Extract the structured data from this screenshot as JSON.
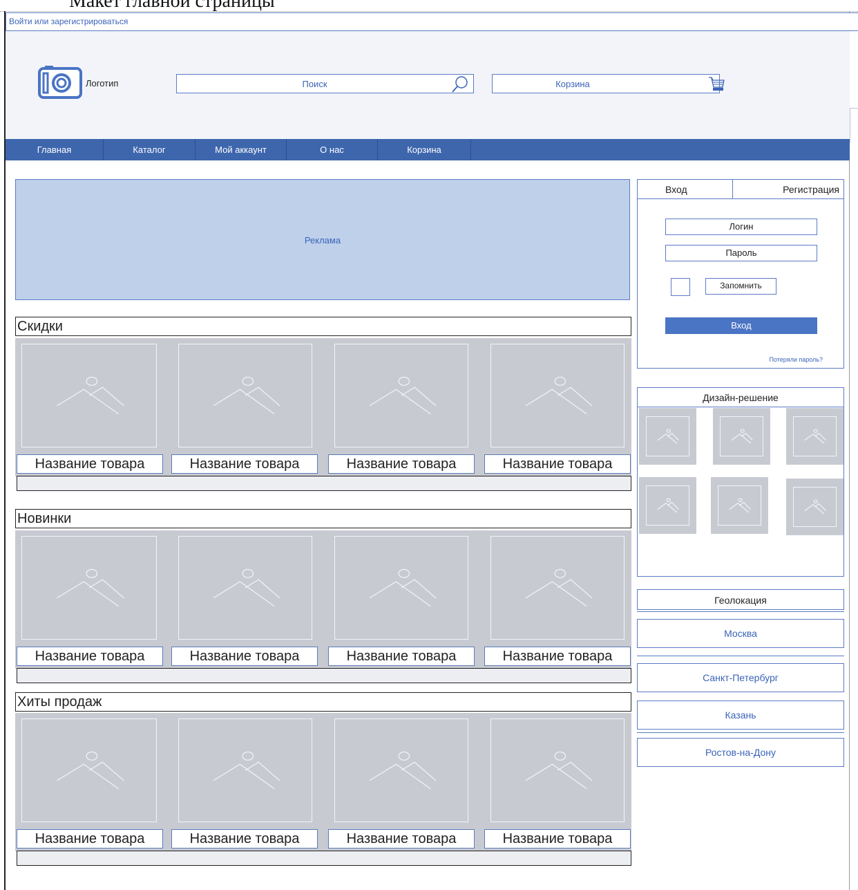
{
  "page_caption": "Макет главной страницы",
  "auth_link": "Войти или зарегистрироваться",
  "header": {
    "logo_label": "Логотип",
    "search_label": "Поиск",
    "cart_label": "Корзина"
  },
  "nav": [
    "Главная",
    "Каталог",
    "Мой аккаунт",
    "О нас",
    "Корзина"
  ],
  "ad_label": "Реклама",
  "sections": [
    {
      "title": "Скидки",
      "products": [
        "Название товара",
        "Название товара",
        "Название товара",
        "Название товара"
      ]
    },
    {
      "title": "Новинки",
      "products": [
        "Название товара",
        "Название товара",
        "Название товара",
        "Название товара"
      ]
    },
    {
      "title": "Хиты продаж",
      "products": [
        "Название товара",
        "Название товара",
        "Название товара",
        "Название товара"
      ]
    }
  ],
  "login_panel": {
    "tab_login": "Вход",
    "tab_register": "Регистрация",
    "login_placeholder": "Логин",
    "password_placeholder": "Пароль",
    "remember_label": "Запомнить",
    "login_button": "Вход",
    "lost_password": "Потеряли пароль?"
  },
  "design_panel": {
    "title": "Дизайн-решение"
  },
  "geo": {
    "title": "Геолокация",
    "cities": [
      "Москва",
      "Санкт-Петербург",
      "Казань",
      "Ростов-на-Дону"
    ]
  },
  "colors": {
    "accent": "#3e66ad",
    "link": "#3a63b8",
    "placeholder": "#c8cad2",
    "banner": "#bed0ea"
  },
  "icons": [
    "camera-icon",
    "search-icon",
    "cart-icon",
    "image-placeholder-icon"
  ]
}
